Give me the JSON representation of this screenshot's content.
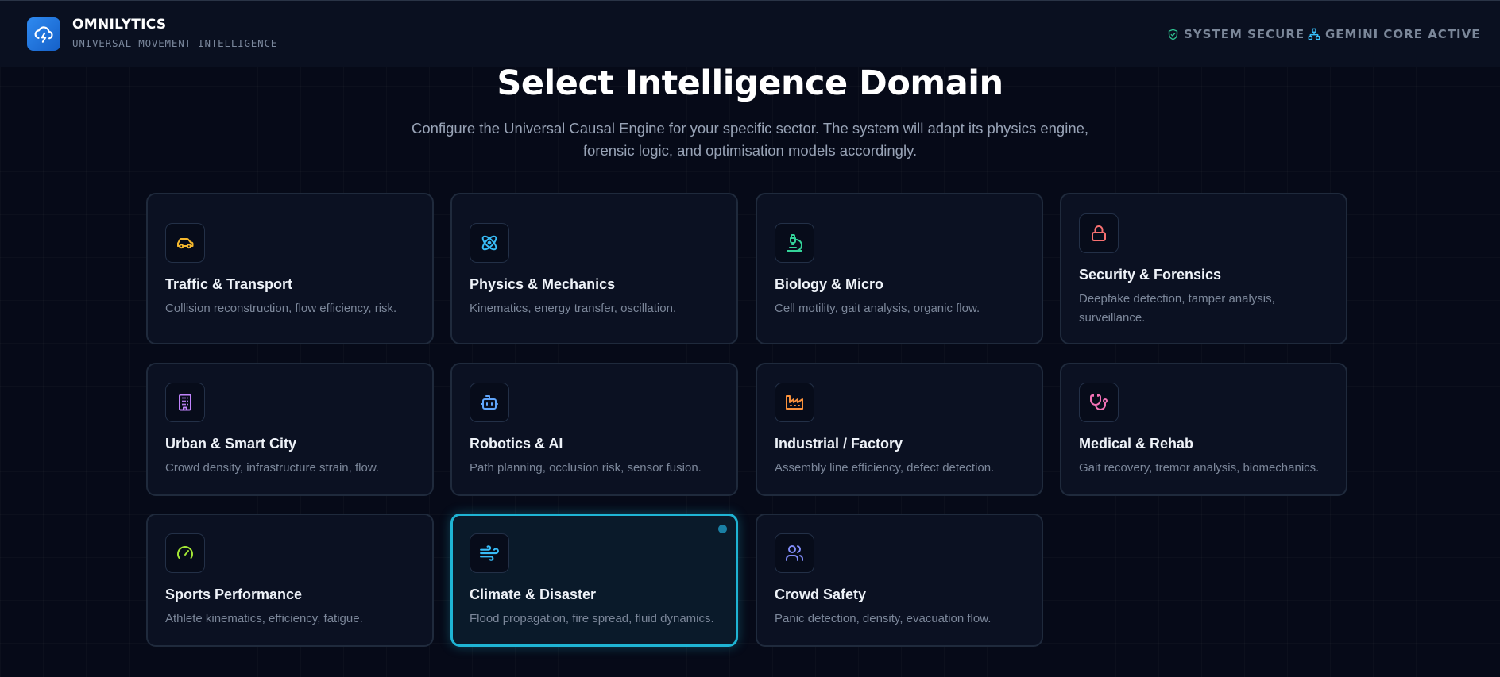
{
  "header": {
    "brand_name": "OMNILYTICS",
    "brand_tagline": "UNIVERSAL MOVEMENT INTELLIGENCE",
    "logo_icon": "cloud-lightning-icon",
    "status_secure": "SYSTEM SECURE",
    "status_core": "GEMINI CORE ACTIVE"
  },
  "main": {
    "heading": "Select Intelligence Domain",
    "subtitle_line1": "Configure the Universal Causal Engine for your specific sector. The system will adapt its physics engine,",
    "subtitle_line2": "forensic logic, and optimisation models accordingly."
  },
  "domains": [
    {
      "title": "Traffic & Transport",
      "description": "Collision reconstruction, flow efficiency, risk.",
      "icon": "car-icon",
      "color": "#f5b82e"
    },
    {
      "title": "Physics & Mechanics",
      "description": "Kinematics, energy transfer, oscillation.",
      "icon": "atom-icon",
      "color": "#38bdf8"
    },
    {
      "title": "Biology & Micro",
      "description": "Cell motility, gait analysis, organic flow.",
      "icon": "microscope-icon",
      "color": "#34d399"
    },
    {
      "title": "Security & Forensics",
      "description": "Deepfake detection, tamper analysis, surveillance.",
      "icon": "lock-icon",
      "color": "#f87171"
    },
    {
      "title": "Urban & Smart City",
      "description": "Crowd density, infrastructure strain, flow.",
      "icon": "building-icon",
      "color": "#c084fc"
    },
    {
      "title": "Robotics & AI",
      "description": "Path planning, occlusion risk, sensor fusion.",
      "icon": "robot-icon",
      "color": "#60a5fa"
    },
    {
      "title": "Industrial / Factory",
      "description": "Assembly line efficiency, defect detection.",
      "icon": "factory-icon",
      "color": "#fb923c"
    },
    {
      "title": "Medical & Rehab",
      "description": "Gait recovery, tremor analysis, biomechanics.",
      "icon": "stethoscope-icon",
      "color": "#f472b6"
    },
    {
      "title": "Sports Performance",
      "description": "Athlete kinematics, efficiency, fatigue.",
      "icon": "gauge-icon",
      "color": "#a3e635"
    },
    {
      "title": "Climate & Disaster",
      "description": "Flood propagation, fire spread, fluid dynamics.",
      "icon": "wind-icon",
      "color": "#38bdf8",
      "selected": true
    },
    {
      "title": "Crowd Safety",
      "description": "Panic detection, density, evacuation flow.",
      "icon": "users-icon",
      "color": "#818cf8"
    }
  ],
  "colors": {
    "accent": "#1fb4d4",
    "background": "#060a18",
    "card": "#0b1122",
    "secure_icon": "#2fbf8f",
    "core_icon": "#38bdf8"
  }
}
